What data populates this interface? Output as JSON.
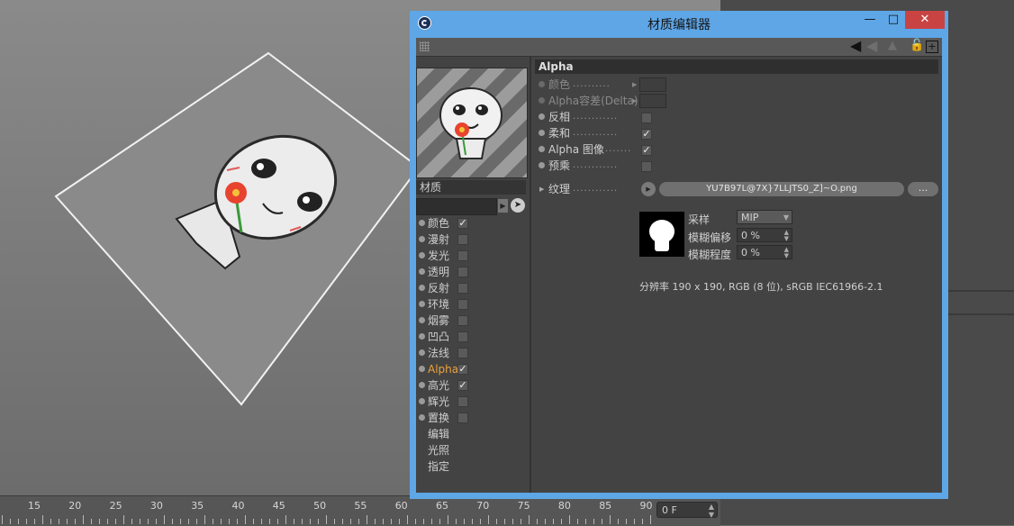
{
  "window": {
    "title": "材质编辑器",
    "minimize": "—",
    "maximize": "□",
    "close": "✕"
  },
  "toolbar": {
    "back_icon": "◀",
    "forward_icon": "◀",
    "up_icon": "▲",
    "lock_icon": "🔓",
    "add_icon": "+"
  },
  "material": {
    "name": "材质"
  },
  "channels": [
    {
      "label": "颜色",
      "checked": "✓"
    },
    {
      "label": "漫射",
      "checked": ""
    },
    {
      "label": "发光",
      "checked": ""
    },
    {
      "label": "透明",
      "checked": ""
    },
    {
      "label": "反射",
      "checked": ""
    },
    {
      "label": "环境",
      "checked": ""
    },
    {
      "label": "烟雾",
      "checked": ""
    },
    {
      "label": "凹凸",
      "checked": ""
    },
    {
      "label": "法线",
      "checked": ""
    },
    {
      "label": "Alpha",
      "checked": "✓"
    },
    {
      "label": "高光",
      "checked": "✓"
    },
    {
      "label": "辉光",
      "checked": ""
    },
    {
      "label": "置换",
      "checked": ""
    }
  ],
  "links": [
    "编辑",
    "光照",
    "指定"
  ],
  "alpha_section": {
    "header": "Alpha",
    "color_label": "颜色",
    "delta_label": "Alpha容差(Delta)",
    "invert_label": "反相",
    "invert_checked": "",
    "soft_label": "柔和",
    "soft_checked": "✓",
    "alpha_image_label": "Alpha 图像",
    "alpha_image_checked": "✓",
    "premultiply_label": "预乘",
    "premultiply_checked": "",
    "texture_label": "纹理",
    "texture_file": "YU7B97L@7X}7LLJTS0_Z]~O.png",
    "more_button": "...",
    "sampling_label": "采样",
    "sampling_value": "MIP",
    "blur_offset_label": "模糊偏移",
    "blur_offset_value": "0 %",
    "blur_scale_label": "模糊程度",
    "blur_scale_value": "0 %",
    "resolution": "分辨率 190 x 190, RGB (8 位), sRGB IEC61966-2.1"
  },
  "timeline": {
    "ticks": [
      "15",
      "20",
      "25",
      "30",
      "35",
      "40",
      "45",
      "50",
      "55",
      "60",
      "65",
      "70",
      "75",
      "80",
      "85",
      "90"
    ],
    "frame": "0 F"
  }
}
